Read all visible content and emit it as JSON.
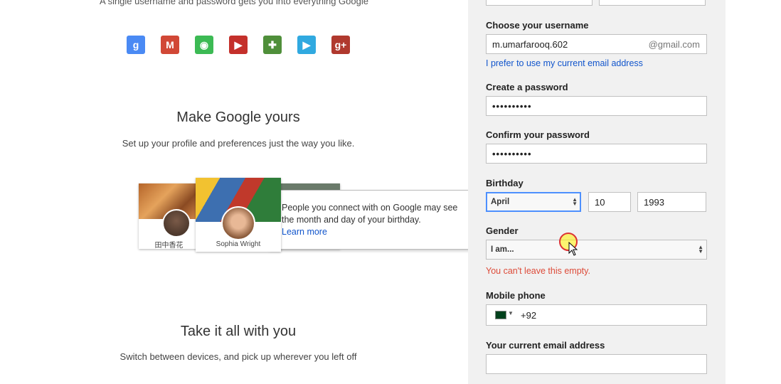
{
  "left": {
    "tagline": "A single username and password gets you into everything Google",
    "apps": [
      {
        "name": "google-search-icon",
        "glyph": "g",
        "color": "#4a8af4"
      },
      {
        "name": "gmail-icon",
        "glyph": "M",
        "color": "#d14836"
      },
      {
        "name": "chrome-icon",
        "glyph": "◉",
        "color": "#3cba54"
      },
      {
        "name": "youtube-icon",
        "glyph": "▶",
        "color": "#c4302b"
      },
      {
        "name": "maps-icon",
        "glyph": "✚",
        "color": "#4f8f3a"
      },
      {
        "name": "play-icon",
        "glyph": "▶",
        "color": "#30a9e0"
      },
      {
        "name": "google-plus-icon",
        "glyph": "g+",
        "color": "#b0392e"
      }
    ],
    "section1_title": "Make Google yours",
    "section1_text": "Set up your profile and preferences just the way you like.",
    "card1_name": "田中香花",
    "card2_name": "Sophia Wright",
    "tooltip_text": "People you connect with on Google may see the month and day of your birthday.",
    "tooltip_link": "Learn more",
    "section2_title": "Take it all with you",
    "section2_text": "Switch between devices, and pick up wherever you left off"
  },
  "form": {
    "username_label": "Choose your username",
    "username_value": "m.umarfarooq.602",
    "username_suffix": "@gmail.com",
    "use_current_email_link": "I prefer to use my current email address",
    "password_label": "Create a password",
    "password_value": "••••••••••",
    "confirm_label": "Confirm your password",
    "confirm_value": "••••••••••",
    "birthday_label": "Birthday",
    "birthday_month": "April",
    "birthday_day": "10",
    "birthday_year": "1993",
    "gender_label": "Gender",
    "gender_value": "I am...",
    "gender_error": "You can't leave this empty.",
    "mobile_label": "Mobile phone",
    "mobile_code": "+92",
    "current_email_label": "Your current email address",
    "current_email_value": ""
  }
}
